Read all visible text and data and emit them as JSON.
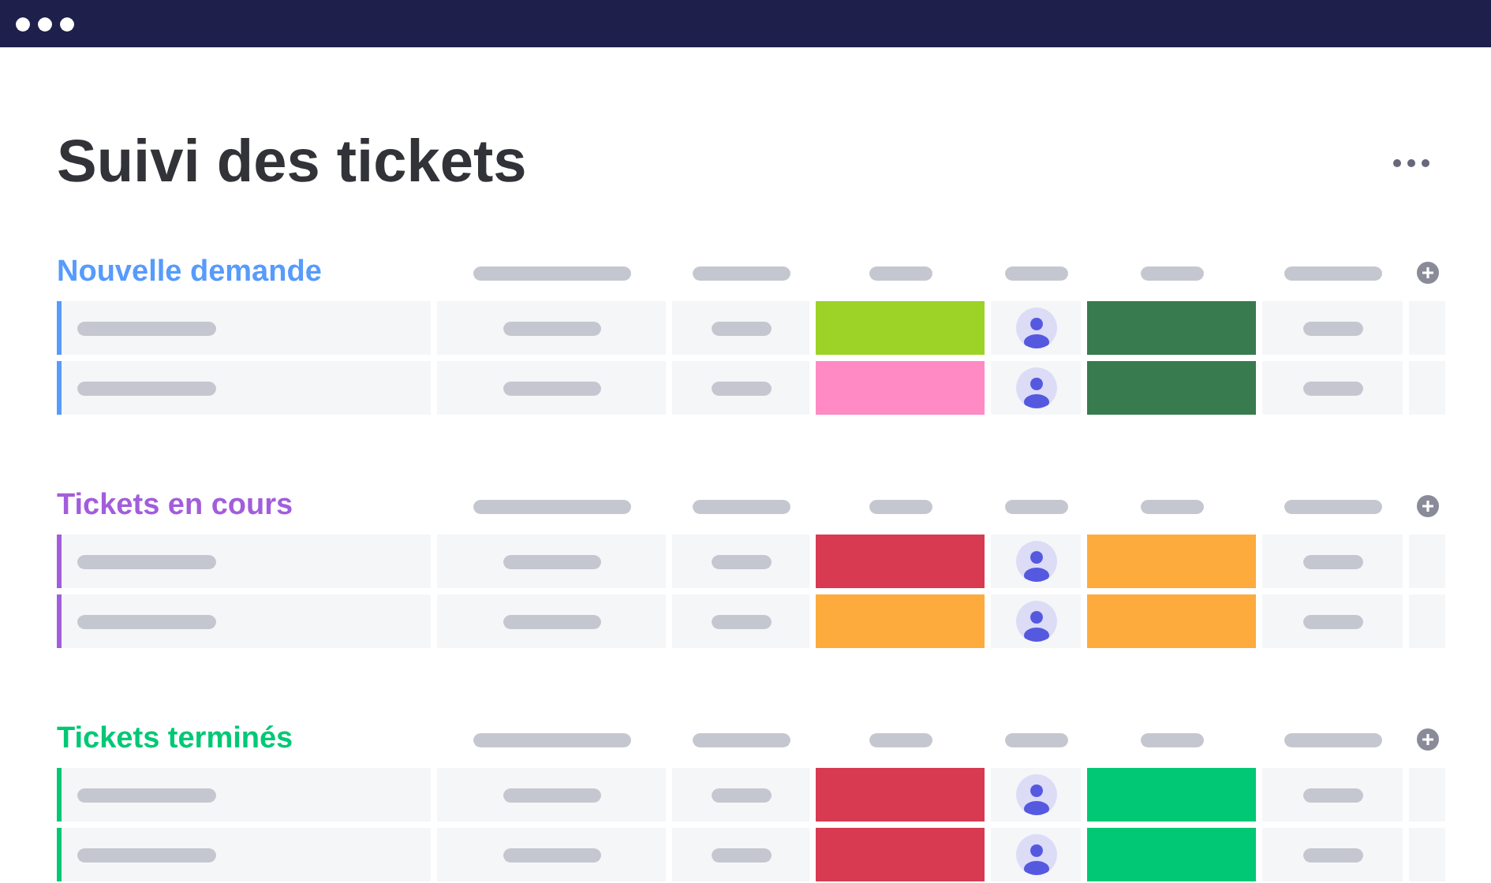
{
  "title": "Suivi des tickets",
  "groups": [
    {
      "title": "Nouvelle demande",
      "color": "#579bfc",
      "rows": [
        {
          "status": {
            "color": "#9cd326"
          },
          "priority": {
            "color": "#377b4f"
          }
        },
        {
          "status": {
            "color": "#ff8ac4"
          },
          "priority": {
            "color": "#377b4f"
          }
        }
      ]
    },
    {
      "title": "Tickets en cours",
      "color": "#a25ddc",
      "rows": [
        {
          "status": {
            "color": "#d83a52"
          },
          "priority": {
            "color": "#fdab3d"
          }
        },
        {
          "status": {
            "color": "#fdab3d"
          },
          "priority": {
            "color": "#fdab3d"
          }
        }
      ]
    },
    {
      "title": "Tickets terminés",
      "color": "#00c875",
      "rows": [
        {
          "status": {
            "color": "#d83a52"
          },
          "priority": {
            "color": "#00c875"
          }
        },
        {
          "status": {
            "color": "#d83a52"
          },
          "priority": {
            "color": "#00c875"
          }
        }
      ]
    }
  ]
}
